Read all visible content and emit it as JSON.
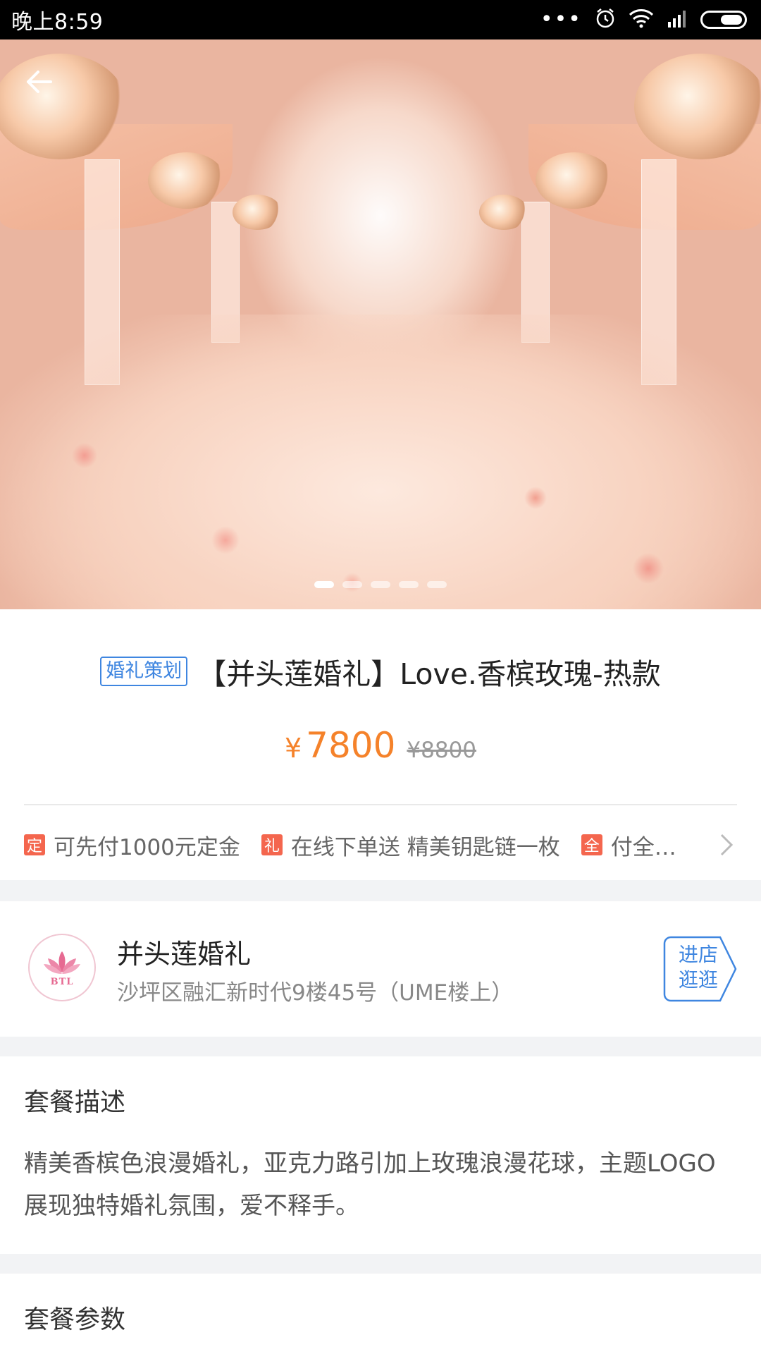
{
  "status_bar": {
    "time": "晚上8:59",
    "more": "•••"
  },
  "gallery": {
    "slide_count": 5,
    "active_index": 0
  },
  "product": {
    "tag": "婚礼策划",
    "title": "【并头莲婚礼】Love.香槟玫瑰-热款",
    "price_symbol": "¥",
    "price": "7800",
    "original_price": "¥8800"
  },
  "promotions": [
    {
      "icon": "定",
      "text": "可先付1000元定金"
    },
    {
      "icon": "礼",
      "text": "在线下单送 精美钥匙链一枚"
    },
    {
      "icon": "全",
      "text": "付全…"
    }
  ],
  "store": {
    "logo_text": "BTL",
    "name": "并头莲婚礼",
    "address": "沙坪区融汇新时代9楼45号（UME楼上）",
    "enter_label": "进店逛逛"
  },
  "description": {
    "heading": "套餐描述",
    "text": "精美香槟色浪漫婚礼，亚克力路引加上玫瑰浪漫花球，主题LOGO展现独特婚礼氛围，爱不释手。"
  },
  "parameters": {
    "heading": "套餐参数"
  },
  "colors": {
    "accent_blue": "#3f86e0",
    "price_orange": "#f5822a",
    "promo_red": "#f4664e"
  },
  "icons": [
    "back-arrow-icon",
    "alarm-icon",
    "wifi-icon",
    "signal-icon",
    "battery-icon",
    "chevron-right-icon",
    "lotus-logo"
  ]
}
